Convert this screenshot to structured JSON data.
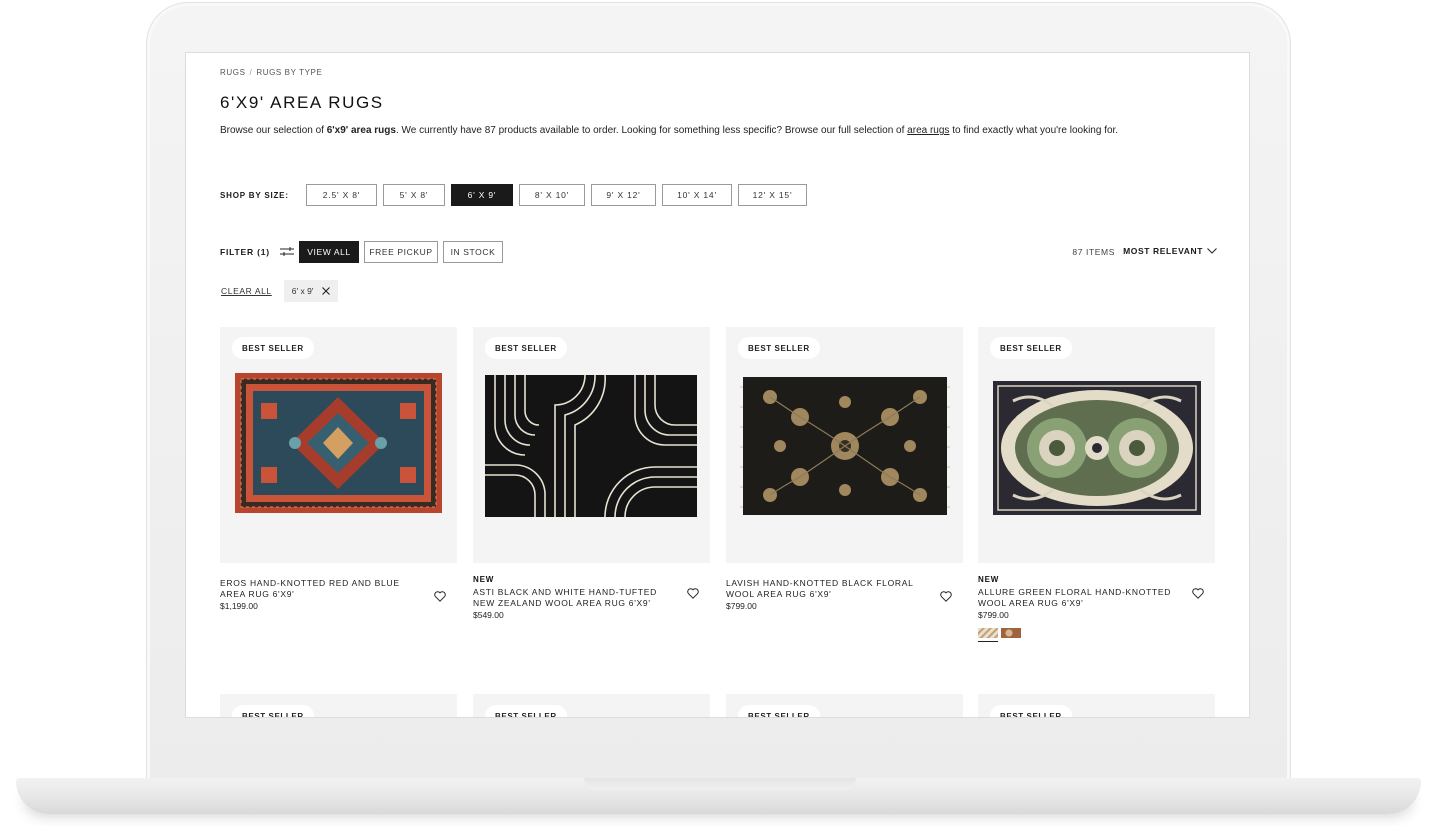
{
  "breadcrumb": {
    "items": [
      "RUGS",
      "RUGS BY TYPE"
    ],
    "separator": "/"
  },
  "page_title": "6'X9' AREA RUGS",
  "intro": {
    "before": "Browse our selection of ",
    "bold": "6'x9' area rugs",
    "middle": ". We currently have 87 products available to order. Looking for something less specific? Browse our full selection of ",
    "link": "area rugs",
    "after": " to find exactly what you're looking for."
  },
  "shop_by_size": {
    "label": "SHOP BY SIZE:",
    "sizes": [
      "2.5' X 8'",
      "5' X 8'",
      "6' X 9'",
      "8' X 10'",
      "9' X 12'",
      "10' X 14'",
      "12' X 15'"
    ],
    "selected": "6' X 9'"
  },
  "filters": {
    "label": "FILTER (1)",
    "buttons": [
      "VIEW ALL",
      "FREE PICKUP",
      "IN STOCK"
    ],
    "selected": "VIEW ALL",
    "items_count": "87 ITEMS",
    "sort": "MOST RELEVANT"
  },
  "applied": {
    "clear_all": "CLEAR ALL",
    "chips": [
      "6' x 9'"
    ]
  },
  "products": [
    {
      "badge": "BEST SELLER",
      "new": "",
      "name": "EROS HAND-KNOTTED RED AND BLUE AREA RUG 6'X9'",
      "price": "$1,199.00",
      "image": "red-blue-persian-rug"
    },
    {
      "badge": "BEST SELLER",
      "new": "NEW",
      "name": "ASTI BLACK AND WHITE HAND-TUFTED NEW ZEALAND WOOL AREA RUG 6'X9'",
      "price": "$549.00",
      "image": "black-white-arches-rug"
    },
    {
      "badge": "BEST SELLER",
      "new": "",
      "name": "LAVISH HAND-KNOTTED BLACK FLORAL WOOL AREA RUG 6'X9'",
      "price": "$799.00",
      "image": "black-floral-rug"
    },
    {
      "badge": "BEST SELLER",
      "new": "NEW",
      "name": "ALLURE GREEN FLORAL HAND-KNOTTED WOOL AREA RUG 6'X9'",
      "price": "$799.00",
      "image": "green-floral-rug",
      "swatches": [
        "cream-stripe",
        "rust-floral"
      ]
    }
  ],
  "next_row_badges": [
    "BEST SELLER",
    "BEST SELLER",
    "BEST SELLER",
    "BEST SELLER"
  ],
  "colors": {
    "accent": "#1a1a1a",
    "card_bg": "#f4f4f4",
    "chip_bg": "#efefef"
  }
}
